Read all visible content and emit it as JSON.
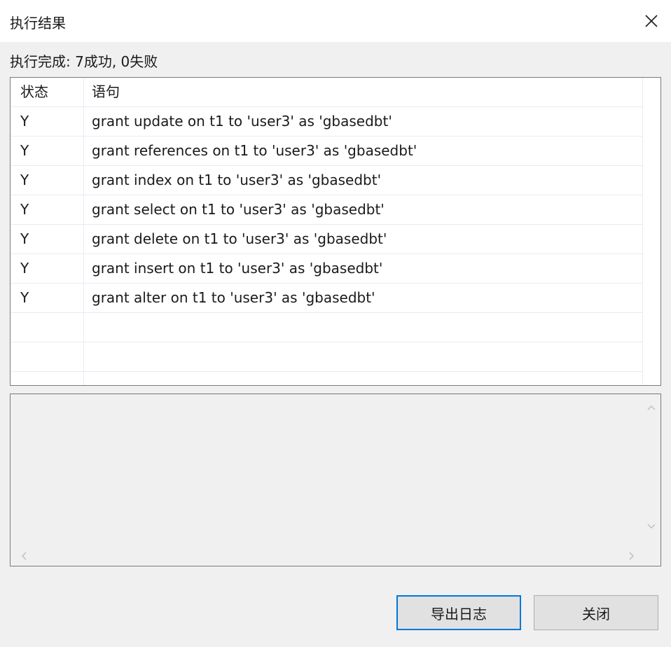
{
  "window": {
    "title": "执行结果",
    "close_icon": "close-icon"
  },
  "summary": "执行完成: 7成功, 0失败",
  "table": {
    "columns": [
      "状态",
      "语句"
    ],
    "rows": [
      {
        "status": "Y",
        "statement": "grant update on t1 to 'user3'  as 'gbasedbt'"
      },
      {
        "status": "Y",
        "statement": "grant references on t1 to 'user3'  as 'gbasedbt'"
      },
      {
        "status": "Y",
        "statement": "grant index on t1 to 'user3'  as 'gbasedbt'"
      },
      {
        "status": "Y",
        "statement": "grant select on t1 to 'user3'  as 'gbasedbt'"
      },
      {
        "status": "Y",
        "statement": "grant delete on t1 to 'user3'  as 'gbasedbt'"
      },
      {
        "status": "Y",
        "statement": "grant insert on t1 to 'user3'  as 'gbasedbt'"
      },
      {
        "status": "Y",
        "statement": "grant alter on t1 to 'user3'  as 'gbasedbt'"
      }
    ]
  },
  "detail": {
    "text": "",
    "scroll_icons": [
      "chevron-up-icon",
      "chevron-down-icon",
      "chevron-left-icon",
      "chevron-right-icon"
    ]
  },
  "buttons": {
    "export_label": "导出日志",
    "close_label": "关闭"
  },
  "colors": {
    "accent": "#0078d7",
    "background": "#f0f0f0",
    "grid_line": "#e6ecf3"
  }
}
